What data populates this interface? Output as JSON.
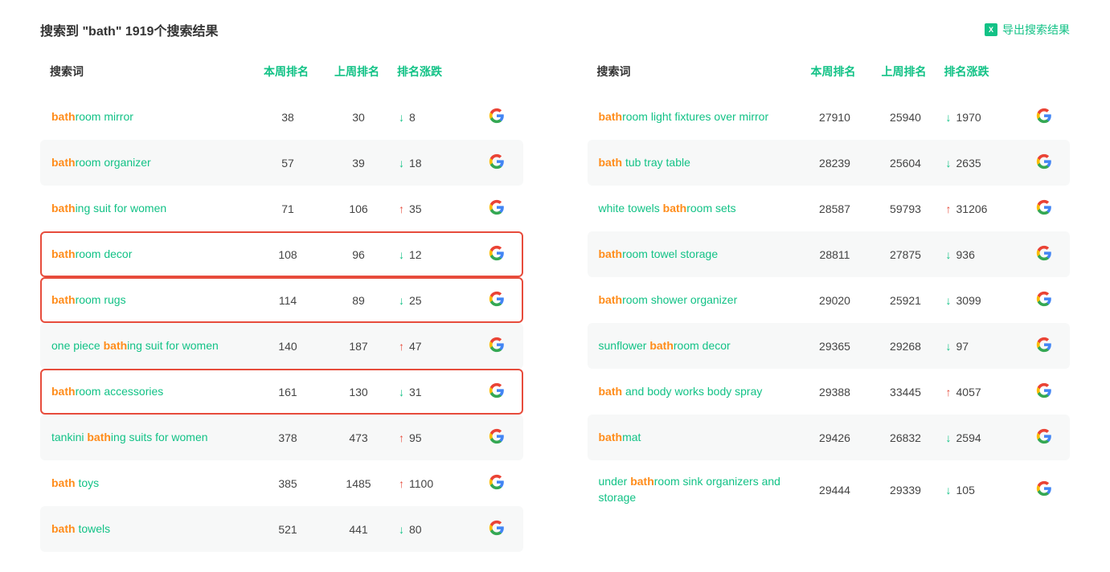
{
  "header": {
    "title_prefix": "搜索到 \"",
    "query": "bath",
    "title_mid": "\" ",
    "result_count": "1919",
    "title_suffix": "个搜索结果",
    "export_label": "导出搜索结果"
  },
  "columns": {
    "term": "搜索词",
    "this_week": "本周排名",
    "last_week": "上周排名",
    "change": "排名涨跌"
  },
  "highlight_match": "bath",
  "left_table": [
    {
      "term": "bathroom mirror",
      "this_week": "38",
      "last_week": "30",
      "change": "8",
      "dir": "down",
      "alt": false,
      "hl": false
    },
    {
      "term": "bathroom organizer",
      "this_week": "57",
      "last_week": "39",
      "change": "18",
      "dir": "down",
      "alt": true,
      "hl": false
    },
    {
      "term": "bathing suit for women",
      "this_week": "71",
      "last_week": "106",
      "change": "35",
      "dir": "up",
      "alt": false,
      "hl": false
    },
    {
      "term": "bathroom decor",
      "this_week": "108",
      "last_week": "96",
      "change": "12",
      "dir": "down",
      "alt": false,
      "hl": true
    },
    {
      "term": "bathroom rugs",
      "this_week": "114",
      "last_week": "89",
      "change": "25",
      "dir": "down",
      "alt": false,
      "hl": true
    },
    {
      "term": "one piece bathing suit for women",
      "this_week": "140",
      "last_week": "187",
      "change": "47",
      "dir": "up",
      "alt": true,
      "hl": false
    },
    {
      "term": "bathroom accessories",
      "this_week": "161",
      "last_week": "130",
      "change": "31",
      "dir": "down",
      "alt": false,
      "hl": true
    },
    {
      "term": "tankini bathing suits for women",
      "this_week": "378",
      "last_week": "473",
      "change": "95",
      "dir": "up",
      "alt": true,
      "hl": false
    },
    {
      "term": "bath toys",
      "this_week": "385",
      "last_week": "1485",
      "change": "1100",
      "dir": "up",
      "alt": false,
      "hl": false
    },
    {
      "term": "bath towels",
      "this_week": "521",
      "last_week": "441",
      "change": "80",
      "dir": "down",
      "alt": true,
      "hl": false
    }
  ],
  "right_table": [
    {
      "term": "bathroom light fixtures over mirror",
      "this_week": "27910",
      "last_week": "25940",
      "change": "1970",
      "dir": "down",
      "alt": false,
      "hl": false
    },
    {
      "term": "bath tub tray table",
      "this_week": "28239",
      "last_week": "25604",
      "change": "2635",
      "dir": "down",
      "alt": true,
      "hl": false
    },
    {
      "term": "white towels bathroom sets",
      "this_week": "28587",
      "last_week": "59793",
      "change": "31206",
      "dir": "up",
      "alt": false,
      "hl": false
    },
    {
      "term": "bathroom towel storage",
      "this_week": "28811",
      "last_week": "27875",
      "change": "936",
      "dir": "down",
      "alt": true,
      "hl": false
    },
    {
      "term": "bathroom shower organizer",
      "this_week": "29020",
      "last_week": "25921",
      "change": "3099",
      "dir": "down",
      "alt": false,
      "hl": false
    },
    {
      "term": "sunflower bathroom decor",
      "this_week": "29365",
      "last_week": "29268",
      "change": "97",
      "dir": "down",
      "alt": true,
      "hl": false
    },
    {
      "term": "bath and body works body spray",
      "this_week": "29388",
      "last_week": "33445",
      "change": "4057",
      "dir": "up",
      "alt": false,
      "hl": false
    },
    {
      "term": "bathmat",
      "this_week": "29426",
      "last_week": "26832",
      "change": "2594",
      "dir": "down",
      "alt": true,
      "hl": false
    },
    {
      "term": "under bathroom sink organizers and storage",
      "this_week": "29444",
      "last_week": "29339",
      "change": "105",
      "dir": "down",
      "alt": false,
      "hl": false
    }
  ]
}
